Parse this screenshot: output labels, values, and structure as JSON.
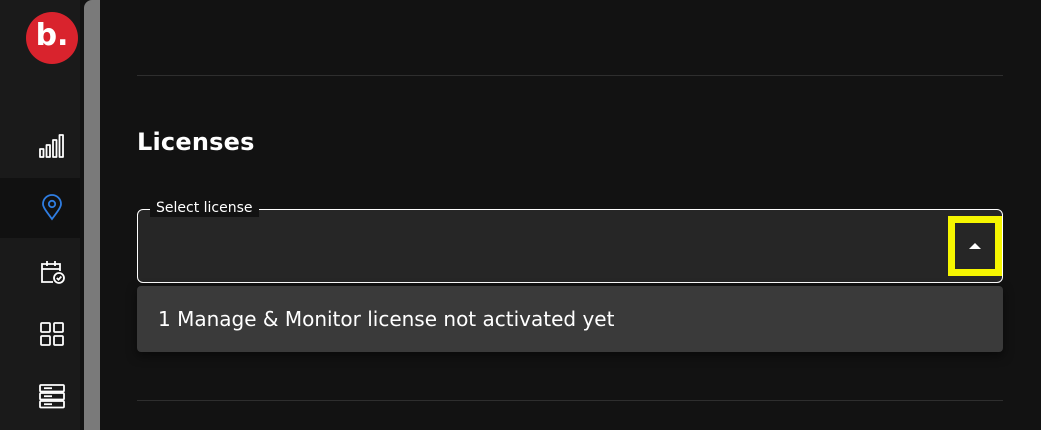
{
  "sidebar": {
    "logo_text": "b.",
    "items": [
      {
        "icon": "bar-chart-icon",
        "active": false
      },
      {
        "icon": "location-pin-icon",
        "active": true
      },
      {
        "icon": "calendar-check-icon",
        "active": false
      },
      {
        "icon": "grid-icon",
        "active": false
      },
      {
        "icon": "server-icon",
        "active": false
      }
    ]
  },
  "colors": {
    "brand": "#d9232d",
    "active_icon": "#2f7de1",
    "highlight": "#f5f500"
  },
  "licenses": {
    "title": "Licenses",
    "select": {
      "label": "Select license",
      "value": ""
    },
    "options": [
      "1 Manage & Monitor license not activated yet"
    ]
  }
}
